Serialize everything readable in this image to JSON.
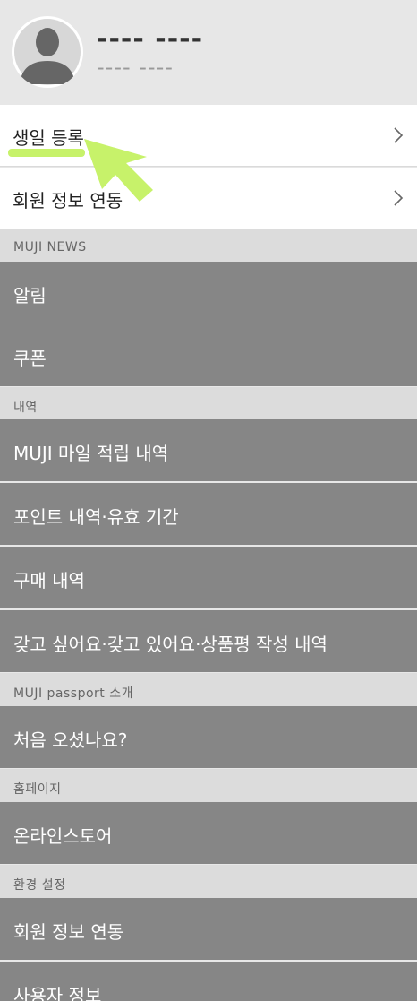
{
  "profile": {
    "name": "---- ----",
    "subtitle": "---- ----"
  },
  "top_rows": [
    {
      "label": "생일 등록"
    },
    {
      "label": "회원 정보 연동"
    }
  ],
  "sections": [
    {
      "title": "MUJI NEWS",
      "items": [
        "알림",
        "쿠폰"
      ]
    },
    {
      "title": "내역",
      "items": [
        "MUJI 마일 적립 내역",
        "포인트 내역·유효 기간",
        "구매 내역",
        "갖고 싶어요·갖고 있어요·상품평 작성 내역"
      ]
    },
    {
      "title": "MUJI passport 소개",
      "items": [
        "처음 오셨나요?"
      ]
    },
    {
      "title": "홈페이지",
      "items": [
        "온라인스토어"
      ]
    },
    {
      "title": "환경 설정",
      "items": [
        "회원 정보 연동",
        "사용자 정보"
      ]
    }
  ],
  "colors": {
    "highlight": "#c7f26a",
    "gray_row": "#868686",
    "section_bg": "#dcdcdc",
    "page_bg": "#e7e7e7"
  },
  "icons": {
    "avatar": "avatar-icon",
    "chevron": "chevron-right-icon",
    "arrow": "arrow-pointer-icon"
  }
}
